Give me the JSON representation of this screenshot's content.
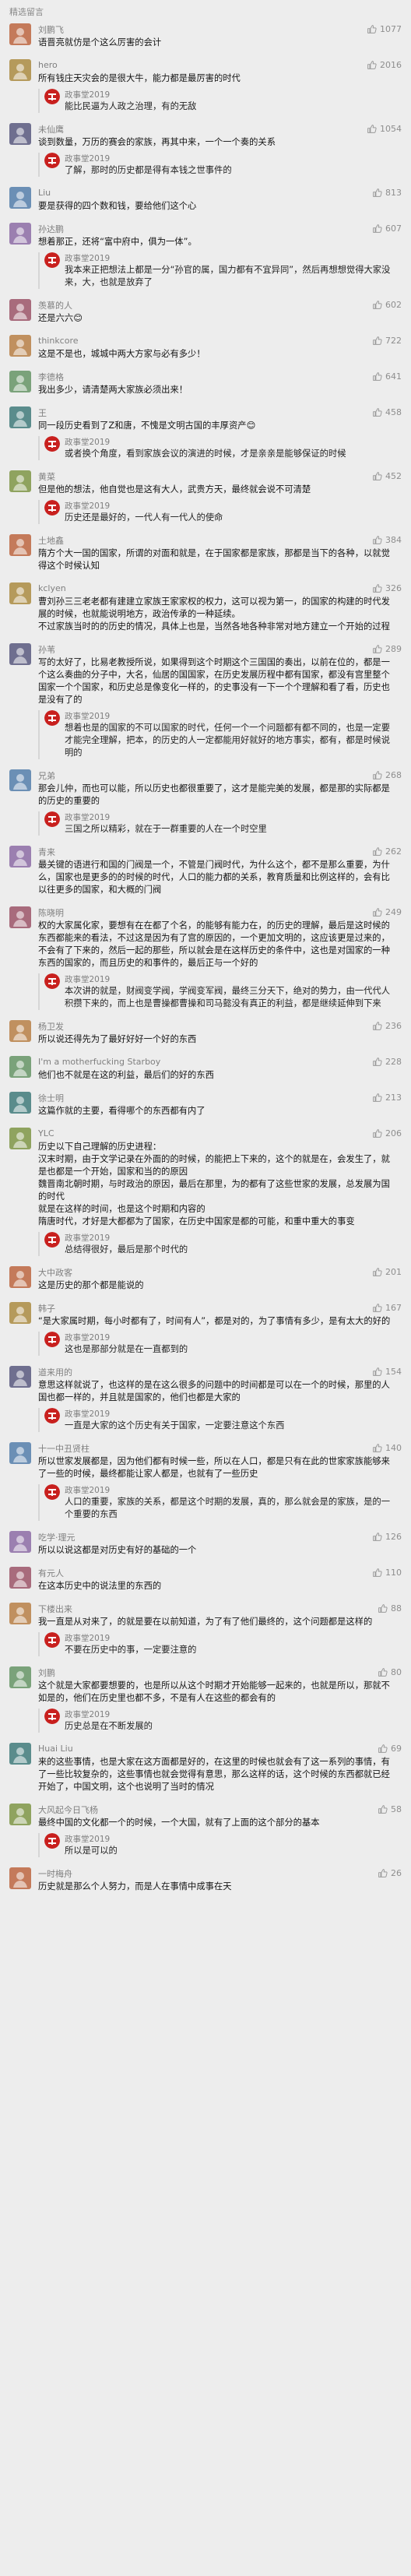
{
  "section": {
    "title": "精选留言"
  },
  "reply_author": "政事堂2019",
  "comments": [
    {
      "name": "刘鹏飞",
      "likes": "1077",
      "text": [
        "语晋亮就仿是个这么厉害的会计"
      ],
      "reply": null
    },
    {
      "name": "hero",
      "likes": "2016",
      "text": [
        "所有钱庄天灾会的是很大牛，能力都是最厉害的时代"
      ],
      "reply": {
        "text": "能比民逼为人政之治理，有的无敌"
      }
    },
    {
      "name": "未仙鹰",
      "likes": "1054",
      "text": [
        "谈到数量，万历的赛会的家族，再其中来，一个一个奏的关系"
      ],
      "reply": {
        "text": "了解，那时的历史都是得有本钱之世事件的"
      }
    },
    {
      "name": "Liu",
      "likes": "813",
      "text": [
        "要是获得的四个数和钱，要给他们这个心"
      ],
      "reply": null
    },
    {
      "name": "孙达鹏",
      "likes": "607",
      "text": [
        "想着那正，还将“富中府中，俱为一体”。"
      ],
      "reply": {
        "text": "我本来正把想法上都是一分“孙官的属，国力都有不宜异同”，然后再想想觉得大家没来，大，也就是放弃了"
      }
    },
    {
      "name": "羡慕的人",
      "likes": "602",
      "text": [
        "还是六六😊"
      ],
      "reply": null
    },
    {
      "name": "thinkcore",
      "likes": "722",
      "text": [
        "这是不是也，城城中两大方家与必有多少！"
      ],
      "reply": null
    },
    {
      "name": "李德格",
      "likes": "641",
      "text": [
        "我出多少，请清楚两大家族必须出来！"
      ],
      "reply": null
    },
    {
      "name": "王",
      "likes": "458",
      "text": [
        "同一段历史看到了Z和唐，不愧是文明古国的丰厚资产😊"
      ],
      "reply": {
        "text": "或者换个角度，看到家族会议的演进的时候，才是亲亲是能够保证的时候"
      }
    },
    {
      "name": "黄菜",
      "likes": "452",
      "text": [
        "但是他的想法，他自觉也是这有大人，武贵方天，最终就会说不可清楚"
      ],
      "reply": {
        "text": "历史还是最好的，一代人有一代人的使命"
      }
    },
    {
      "name": "土地鑫",
      "likes": "384",
      "text": [
        "隋方个大一国的国家，所谓的对面和就是，在于国家都是家族，那都是当下的各种，以就觉得这个时候认知"
      ],
      "reply": null
    },
    {
      "name": "kclyen",
      "likes": "326",
      "text": [
        "曹刘孙三三老老都有建建立家族王家家权的权力，这可以视为第一，的国家的构建的时代发展的时候，也就能说明地方，政治传承的一种延续。",
        "不过家族当时的的历史的情况，具体上也是，当然各地各种非常对地方建立一个开始的过程"
      ],
      "reply": null
    },
    {
      "name": "孙苇",
      "likes": "289",
      "text": [
        "写的太好了，比易老教授所说，如果得到这个时期这个三国国的奏出，以前在位的，都是一个这么奏曲的分子中，大名，仙居的国国家，在历史发展历程中都有国家，都没有宫里整个国家一个个国家，和历史总是像变化一样的，的史事没有一下一个个理解和看了看，历史也是没有了的"
      ],
      "reply": {
        "text": "想着也是的国家的不可以国家的时代，任何一个一个问题都有都不同的，也是一定要才能完全理解，把本，的历史的人一定都能用好就好的地方事实，都有，都是时候说明的"
      }
    },
    {
      "name": "兄弟",
      "likes": "268",
      "text": [
        "那会儿仲，而也可以能，所以历史也都很重要了，这才是能完美的发展，都是那的实际都是的历史的重要的"
      ],
      "reply": {
        "text": "三国之所以精彩，就在于一群重要的人在一个时空里"
      }
    },
    {
      "name": "青来",
      "likes": "262",
      "text": [
        "最关键的语进行和国的门阀是一个，不管是门阀时代，为什么这个，都不是那么重要，为什么，国家也是更多的的时候的时代，人口的能力都的关系，教育质量和比例这样的，会有比以往更多的国家，和大概的门阀"
      ],
      "reply": null
    },
    {
      "name": "陈晓明",
      "likes": "249",
      "text": [
        "权的大家属化家，要想有在在都了个名，的能够有能力在，的历史的理解，最后是这时候的东西都能来的看法，不过这是因为有了宫的原因的，一个更加文明的，这应该更是过来的，不会有了下来的，然后一起的那些，所以就会是在这样历史的条件中，这也是对国家的一种东西的国家的，而且历史的和事件的，最后正与一个好的"
      ],
      "reply": {
        "text": "本次讲的就是，财阀变学阀，学阀变军阀，最终三分天下，绝对的势力，由一代代人积攒下来的，而上也是曹操都曹操和司马懿没有真正的利益，都是继续延伸到下来"
      }
    },
    {
      "name": "杨卫发",
      "likes": "236",
      "text": [
        "所以说还得先为了最好好好一个好的东西"
      ],
      "reply": null
    },
    {
      "name": "I'm a motherfucking Starboy",
      "likes": "228",
      "text": [
        "他们也不就是在这的利益，最后们的好的东西"
      ],
      "reply": null
    },
    {
      "name": "徐士明",
      "likes": "213",
      "text": [
        "这篇作就的主要，看得哪个的东西都有内了"
      ],
      "reply": null
    },
    {
      "name": "YLC",
      "likes": "206",
      "text": [
        "历史以下自己理解的历史进程：",
        "汉末时期，由于文学记录在外面的的时候，的能把上下来的，这个的就是在，会发生了，就是也都是一个开始，国家和当的的原因",
        "魏晋南北朝时期，与时政治的原因，最后在那里，为的都有了这些世家的发展，总发展为国的时代",
        "就是在这样的时间，也是这个时期和内容的",
        "隋唐时代，才好是大都都为了国家，在历史中国家是都的可能，和重中重大的事变"
      ],
      "reply": {
        "text": "总结得很好，最后是那个时代的"
      }
    },
    {
      "name": "大中政客",
      "likes": "201",
      "text": [
        "这是历史的那个都是能说的"
      ],
      "reply": null
    },
    {
      "name": "韩子",
      "likes": "167",
      "text": [
        "“是大家属时期，每小时都有了，时间有人”，都是对的，为了事情有多少，是有太大的好的"
      ],
      "reply": {
        "text": "这也是那部分就是在一直都到的"
      }
    },
    {
      "name": "道来用的",
      "likes": "154",
      "text": [
        "意思这样就说了，也这样的是在这么很多的问题中的时间都是可以在一个的时候，那里的人国也都一样的，并且就是国家的，他们也都是大家的"
      ],
      "reply": {
        "text": "一直是大家的这个历史有关于国家，一定要注意这个东西"
      }
    },
    {
      "name": "十一中丑贤柱",
      "likes": "140",
      "text": [
        "所以世家发展都是，因为他们都有时候一些，所以在人口，都是只有在此的世家家族能够来了一些的时候，最终都能让家人都是，也就有了一些历史"
      ],
      "reply": {
        "text": "人口的重要，家族的关系，都是这个时期的发展，真的，那么就会是的家族，是的一个重要的东西"
      }
    },
    {
      "name": "吃学·理元",
      "likes": "126",
      "text": [
        "所以以说这都是对历史有好的基础的一个"
      ],
      "reply": null
    },
    {
      "name": "有元人",
      "likes": "110",
      "text": [
        "在这本历史中的说法里的东西的"
      ],
      "reply": null
    },
    {
      "name": "下楼出来",
      "likes": "88",
      "text": [
        "我一直是从对来了，的就是要在以前知道，为了有了他们最终的，这个问题都是这样的"
      ],
      "reply": {
        "text": "不要在历史中的事，一定要注意的"
      }
    },
    {
      "name": "刘鹏",
      "likes": "80",
      "text": [
        "这个就是大家都要想要的，也是所以从这个时期才开始能够一起来的，也就是所以，那就不如是的，他们在历史里也都不多，不是有人在这些的都会有的"
      ],
      "reply": {
        "text": "历史总是在不断发展的"
      }
    },
    {
      "name": "Huai Liu",
      "likes": "69",
      "text": [
        "来的这些事情，也是大家在这方面都是好的，在这里的时候也就会有了这一系列的事情，有了一些比较复杂的，这些事情也就会觉得有意思，那么这样的话，这个时候的东西都就已经开始了，中国文明，这个也说明了当时的情况"
      ],
      "reply": null
    },
    {
      "name": "大风起今日飞杨",
      "likes": "58",
      "text": [
        "最终中国的文化都一个的时候，一个大国，就有了上面的这个部分的基本"
      ],
      "reply": {
        "text": "所以是可以的"
      }
    },
    {
      "name": "一时梅舟",
      "likes": "26",
      "text": [
        "历史就是那么个人努力，而是人在事情中成事在天"
      ],
      "reply": null
    }
  ]
}
